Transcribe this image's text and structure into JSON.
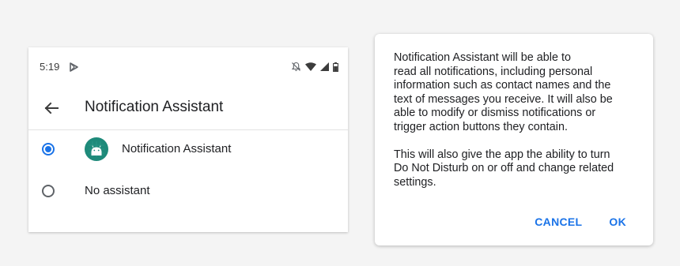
{
  "status_bar": {
    "time": "5:19",
    "icons": [
      "play-store-icon",
      "notifications-off-icon",
      "wifi-icon",
      "signal-icon",
      "battery-icon"
    ]
  },
  "app_bar": {
    "title": "Notification Assistant"
  },
  "options": [
    {
      "label": "Notification Assistant",
      "selected": true,
      "icon": "android-app-icon"
    },
    {
      "label": "No assistant",
      "selected": false
    }
  ],
  "dialog": {
    "paragraph_1": "Notification Assistant will be able to\nread all notifications, including personal\ninformation such as contact names and the\ntext of messages you receive. It will also be\nable to modify or dismiss notifications or\ntrigger action buttons they contain.",
    "paragraph_2": "This will also give the app the ability to turn\nDo Not Disturb on or off and change related\nsettings.",
    "cancel_label": "CANCEL",
    "ok_label": "OK"
  },
  "colors": {
    "accent": "#1a73e8",
    "app_icon_bg": "#1e8a7a",
    "background": "#f4f4f4"
  }
}
